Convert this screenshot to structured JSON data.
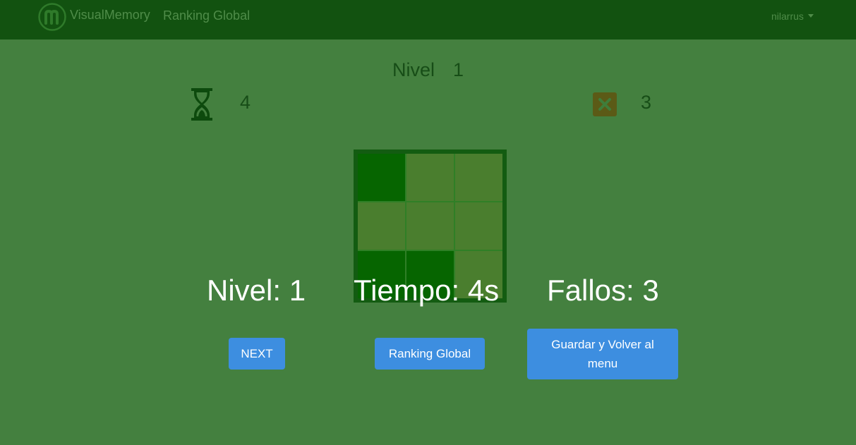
{
  "navbar": {
    "brand": "VisualMemory",
    "link_ranking": "Ranking Global",
    "user": "nilarrus",
    "logo_icon": "m-logo-icon"
  },
  "game": {
    "level_label": "Nivel",
    "level_value": "1",
    "time_icon": "hourglass-icon",
    "time_value": "4",
    "fail_icon": "close-icon",
    "fail_value": "3",
    "board": {
      "rows": 3,
      "cols": 3,
      "cells": [
        [
          true,
          false,
          false
        ],
        [
          false,
          false,
          false
        ],
        [
          true,
          true,
          false
        ]
      ]
    }
  },
  "results": {
    "level": "Nivel: 1",
    "time": "Tiempo: 4s",
    "fails": "Fallos: 3"
  },
  "buttons": {
    "next": "NEXT",
    "ranking": "Ranking Global",
    "save_return": "Guardar y Volver al menu"
  },
  "colors": {
    "background": "#44803f",
    "navbar": "#125210",
    "cell_active": "#066500",
    "cell_inactive": "#4a7e2e",
    "button": "#3d8ee0"
  }
}
